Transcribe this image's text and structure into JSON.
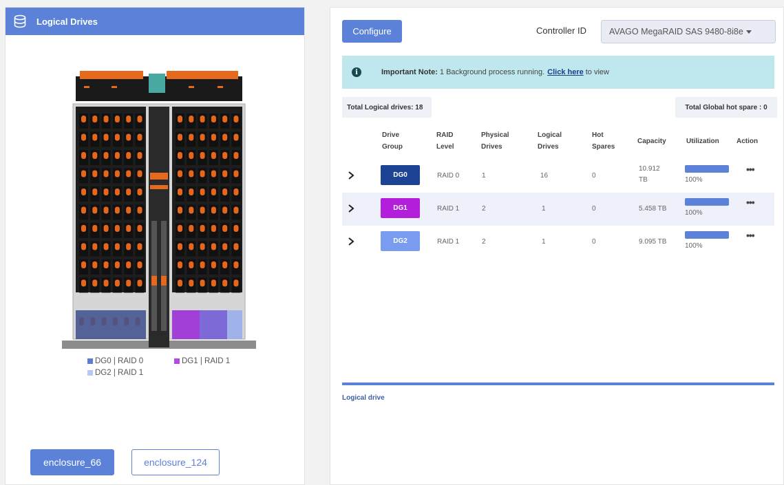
{
  "left_panel": {
    "title": "Logical Drives",
    "icon": "database-icon",
    "legend": [
      {
        "label": "DG0 | RAID 0",
        "color": "#5b7dd6"
      },
      {
        "label": "DG1 | RAID 1",
        "color": "#b44ae6"
      },
      {
        "label": "DG2 | RAID 1",
        "color": "#b8c8f5"
      }
    ],
    "enclosures": [
      "enclosure_66",
      "enclosure_124"
    ],
    "selected_enclosure": "enclosure_66"
  },
  "toolbar": {
    "configure_label": "Configure",
    "controller_label": "Controller ID",
    "controller_value": "AVAGO MegaRAID SAS 9480-8i8e"
  },
  "note": {
    "bold": "Important Note:",
    "text": "1 Background process running.",
    "link": "Click here",
    "tail": "to view"
  },
  "totals": {
    "logical": "Total Logical drives: 18",
    "hot_spare": "Total Global hot spare : 0"
  },
  "table": {
    "headers": {
      "drive_group": [
        "Drive",
        "Group"
      ],
      "raid_level": [
        "RAID",
        "Level"
      ],
      "physical": [
        "Physical",
        "Drives"
      ],
      "logical": [
        "Logical",
        "Drives"
      ],
      "hot": [
        "Hot",
        "Spares"
      ],
      "capacity": "Capacity",
      "utilization": "Utilization",
      "action": "Action"
    },
    "rows": [
      {
        "dg": "DG0",
        "color": "#1d4494",
        "raid": "RAID 0",
        "physical": "1",
        "logical": "16",
        "hot": "0",
        "capacity": "10.912 TB",
        "utilization": "100%",
        "util_fraction": 1.0,
        "action": "•••"
      },
      {
        "dg": "DG1",
        "color": "#b21ed9",
        "raid": "RAID 1",
        "physical": "2",
        "logical": "1",
        "hot": "0",
        "capacity": "5.458 TB",
        "utilization": "100%",
        "util_fraction": 1.0,
        "action": "•••"
      },
      {
        "dg": "DG2",
        "color": "#7a9cf0",
        "raid": "RAID 1",
        "physical": "2",
        "logical": "1",
        "hot": "0",
        "capacity": "9.095 TB",
        "utilization": "100%",
        "util_fraction": 1.0,
        "action": "•••"
      }
    ]
  },
  "logical_drive_label": "Logical drive",
  "colors": {
    "accent": "#5b82d8",
    "note_bg": "#bfe8ee"
  }
}
